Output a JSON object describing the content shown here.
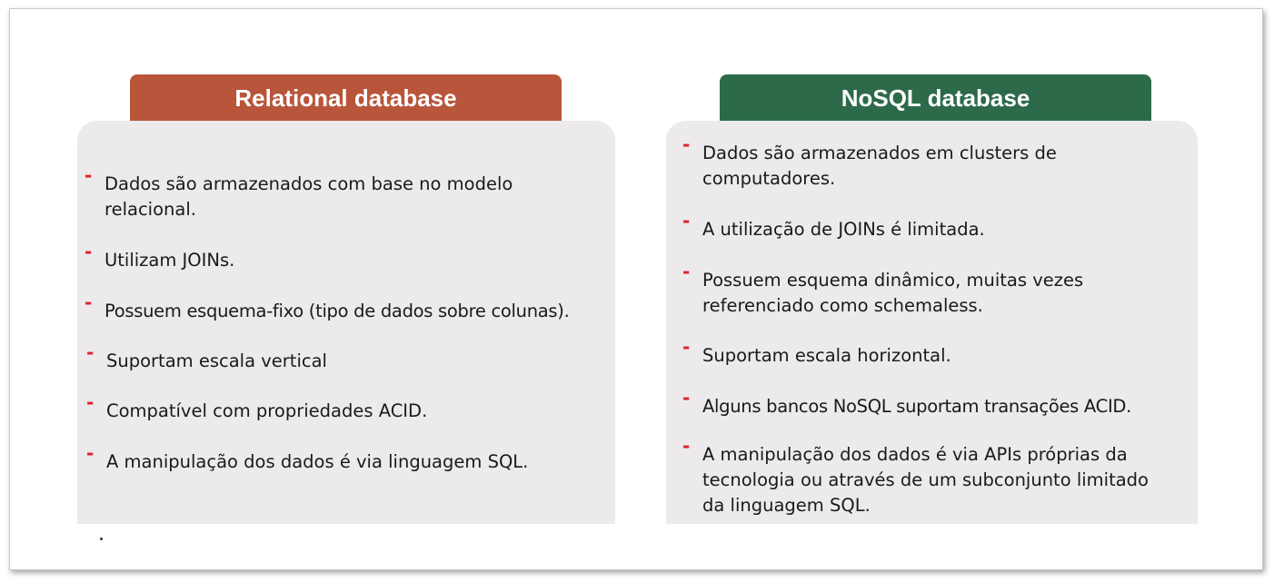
{
  "colors": {
    "relational_header": "#b8553a",
    "nosql_header": "#2d6a4a",
    "panel_bg": "#eceaea",
    "bullet": "#e0202a"
  },
  "relational": {
    "title": "Relational database",
    "items": [
      "Dados são armazenados com base no modelo relacional.",
      "Utilizam JOINs.",
      "Possuem esquema-fixo (tipo de dados sobre colunas).",
      "Suportam escala vertical",
      "Compatível com propriedades ACID.",
      "A manipulação dos dados é via linguagem SQL."
    ]
  },
  "nosql": {
    "title": "NoSQL database",
    "items": [
      "Dados são armazenados em clusters de computadores.",
      "A utilização de JOINs é limitada.",
      "Possuem esquema dinâmico, muitas vezes referenciado como schemaless.",
      "Suportam escala horizontal.",
      "Alguns bancos NoSQL suportam transações ACID.",
      "A manipulação dos dados é via APIs próprias da tecnologia ou através de um subconjunto limitado da linguagem SQL."
    ]
  }
}
